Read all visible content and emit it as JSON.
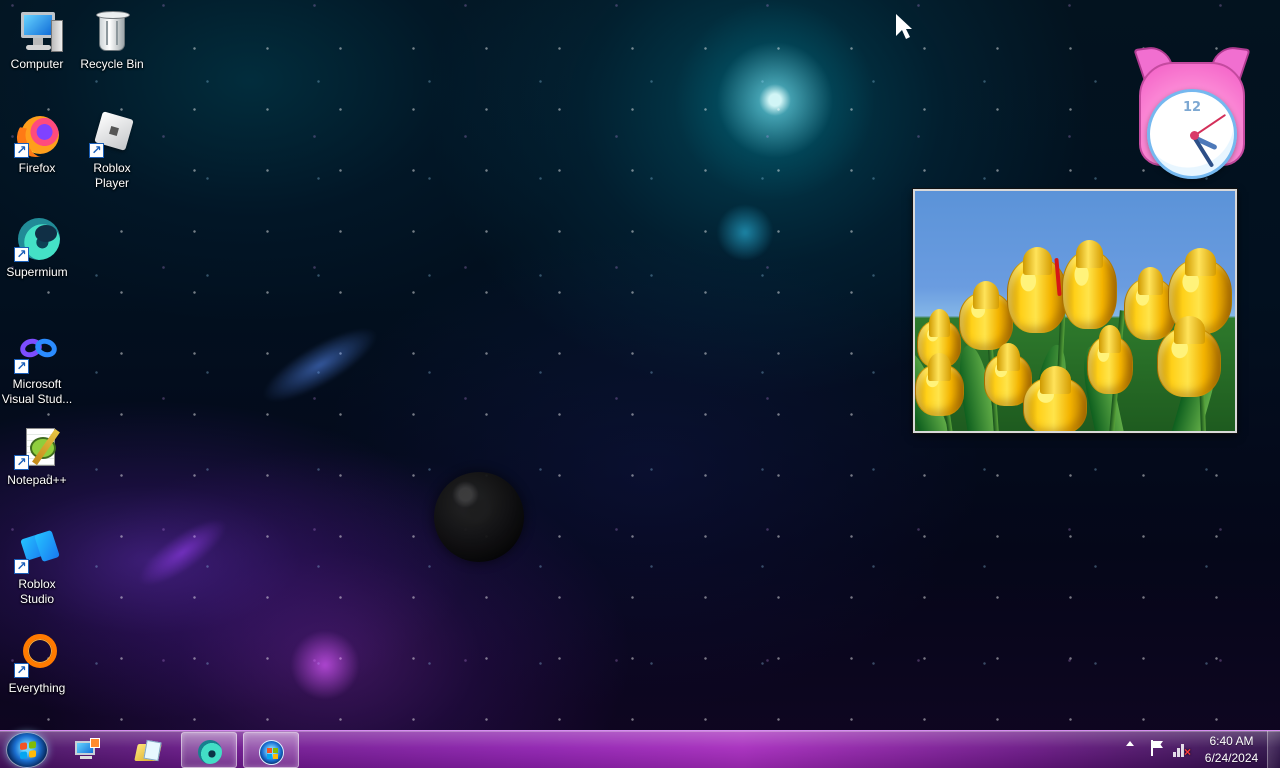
{
  "desktop": {
    "icons": [
      {
        "label": "Computer",
        "icon": "computer-icon"
      },
      {
        "label": "Recycle Bin",
        "icon": "recycle-bin-icon"
      },
      {
        "label": "Firefox",
        "icon": "firefox-icon"
      },
      {
        "label": "Roblox Player",
        "icon": "roblox-player-icon"
      },
      {
        "label": "Supermium",
        "icon": "supermium-icon"
      },
      {
        "label": "Microsoft Visual Stud...",
        "icon": "visual-studio-icon"
      },
      {
        "label": "Notepad++",
        "icon": "notepad-plus-plus-icon"
      },
      {
        "label": "Roblox Studio",
        "icon": "roblox-studio-icon"
      },
      {
        "label": "Everything",
        "icon": "everything-search-icon"
      }
    ]
  },
  "gadgets": {
    "clock": {
      "face_number": "12",
      "icon": "cat-clock-icon"
    },
    "slideshow": {
      "icon": "yellow-tulips-photo"
    }
  },
  "taskbar": {
    "start_icon": "windows-start-icon",
    "apps": [
      {
        "icon": "remote-desktop-icon"
      },
      {
        "icon": "file-explorer-icon"
      },
      {
        "icon": "supermium-icon"
      },
      {
        "icon": "windows-orb-icon"
      }
    ],
    "tray": {
      "time": "6:40 AM",
      "date": "6/24/2024",
      "icons": [
        "hidden-icons-arrow-icon",
        "action-center-flag-icon",
        "network-disconnected-icon"
      ]
    }
  },
  "colors": {
    "taskbar_purple": "#8e20af",
    "desktop_blue": "#02101f",
    "nebula_purple": "#7636d7",
    "clock_pink": "#f25bc5"
  }
}
